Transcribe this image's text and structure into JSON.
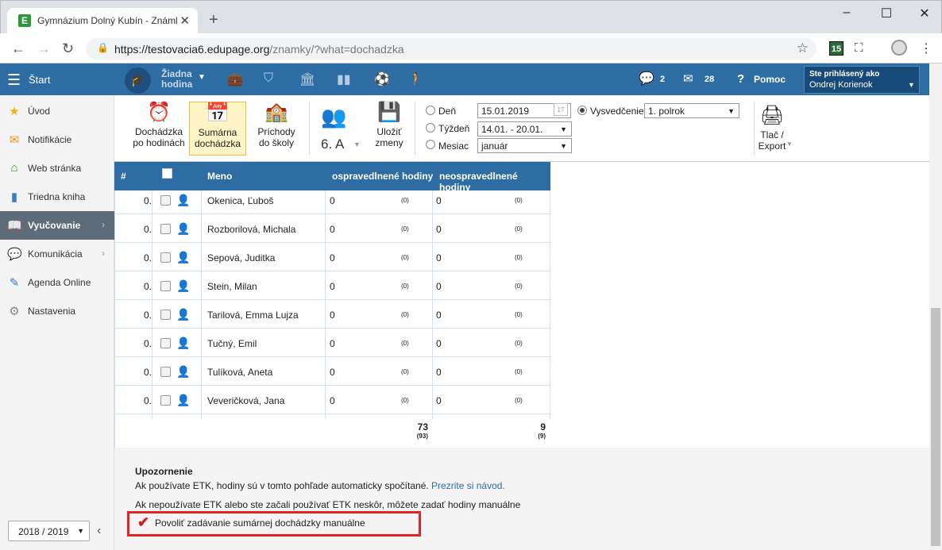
{
  "browser": {
    "tab_title": "Gymnázium Dolný Kubín - Známky",
    "favicon_letter": "E",
    "url_host": "https://testovacia6.edupage.org",
    "url_path": "/znamky/?what=dochadzka",
    "extension_badge": "15"
  },
  "header": {
    "start_label": "Štart",
    "hour_label_1": "Žiadna",
    "hour_label_2": "hodina",
    "messages_count": "2",
    "mail_count": "28",
    "help_label": "Pomoc",
    "user_label": "Ste prihlásený ako",
    "user_name": "Ondrej Korienok"
  },
  "sidebar": {
    "items": [
      {
        "label": "Úvod",
        "icon": "star-icon",
        "color": "#f2b01e"
      },
      {
        "label": "Notifikácie",
        "icon": "envelope-icon",
        "color": "#f0921e"
      },
      {
        "label": "Web stránka",
        "icon": "home-icon",
        "color": "#2b9a3b"
      },
      {
        "label": "Triedna kniha",
        "icon": "book-icon",
        "color": "#3a7fc4"
      },
      {
        "label": "Vyučovanie",
        "icon": "open-book-icon",
        "color": "#ffffff"
      },
      {
        "label": "Komunikácia",
        "icon": "chat-icon",
        "color": "#d64444"
      },
      {
        "label": "Agenda Online",
        "icon": "pen-icon",
        "color": "#3a7fc4"
      },
      {
        "label": "Nastavenia",
        "icon": "gear-icon",
        "color": "#888888"
      }
    ],
    "year": "2018 / 2019"
  },
  "toolbar": {
    "btn_hourly_1": "Dochádzka",
    "btn_hourly_2": "po hodinách",
    "btn_summary_1": "Sumárna",
    "btn_summary_2": "dochádzka",
    "btn_arrivals_1": "Príchody",
    "btn_arrivals_2": "do školy",
    "class_name": "6. A",
    "btn_save_1": "Uložiť",
    "btn_save_2": "zmeny",
    "radio_day": "Deň",
    "radio_week": "Týždeň",
    "radio_month": "Mesiac",
    "radio_report": "Vysvedčenie",
    "day_value": "15.01.2019",
    "week_value": "14.01. - 20.01.",
    "month_value": "január",
    "report_value": "1. polrok",
    "print_1": "Tlač /",
    "print_2": "Export"
  },
  "table": {
    "headers": {
      "num": "#",
      "name": "Meno",
      "excused": "ospravedlnené hodiny",
      "unexcused": "neospravedlnené hodiny"
    },
    "rows": [
      {
        "num": "0.",
        "name": "Okenica, Ľuboš",
        "excused": "0",
        "excused_sub": "(0)",
        "unexcused": "0",
        "unexcused_sub": "(0)",
        "gender": "male"
      },
      {
        "num": "0.",
        "name": "Rozborilová, Michala",
        "excused": "0",
        "excused_sub": "(0)",
        "unexcused": "0",
        "unexcused_sub": "(0)",
        "gender": "female"
      },
      {
        "num": "0.",
        "name": "Sepová, Juditka",
        "excused": "0",
        "excused_sub": "(0)",
        "unexcused": "0",
        "unexcused_sub": "(0)",
        "gender": "female"
      },
      {
        "num": "0.",
        "name": "Stein, Milan",
        "excused": "0",
        "excused_sub": "(0)",
        "unexcused": "0",
        "unexcused_sub": "(0)",
        "gender": "male"
      },
      {
        "num": "0.",
        "name": "Tarilová, Emma Lujza",
        "excused": "0",
        "excused_sub": "(0)",
        "unexcused": "0",
        "unexcused_sub": "(0)",
        "gender": "female"
      },
      {
        "num": "0.",
        "name": "Tučný, Emil",
        "excused": "0",
        "excused_sub": "(0)",
        "unexcused": "0",
        "unexcused_sub": "(0)",
        "gender": "male"
      },
      {
        "num": "0.",
        "name": "Tulíková, Aneta",
        "excused": "0",
        "excused_sub": "(0)",
        "unexcused": "0",
        "unexcused_sub": "(0)",
        "gender": "female"
      },
      {
        "num": "0.",
        "name": "Veveričková, Jana",
        "excused": "0",
        "excused_sub": "(0)",
        "unexcused": "0",
        "unexcused_sub": "(0)",
        "gender": "female"
      }
    ],
    "total_excused": "73",
    "total_excused_sub": "(93)",
    "total_unexcused": "9",
    "total_unexcused_sub": "(9)"
  },
  "notice": {
    "title": "Upozornenie",
    "line1": "Ak používate ETK, hodiny sú v tomto pohľade automaticky spočítané.",
    "link": "Prezrite si návod.",
    "line2": "Ak nepoužívate ETK alebo ste začali používať ETK neskôr, môžete zadať hodiny manuálne",
    "checkbox_label": "Povoliť zadávanie sumárnej dochádzky manuálne",
    "checkbox_checked": true
  },
  "colors": {
    "header": "#2e6da4",
    "highlight_border": "#e12424",
    "selected_button": "#fff4c6"
  }
}
